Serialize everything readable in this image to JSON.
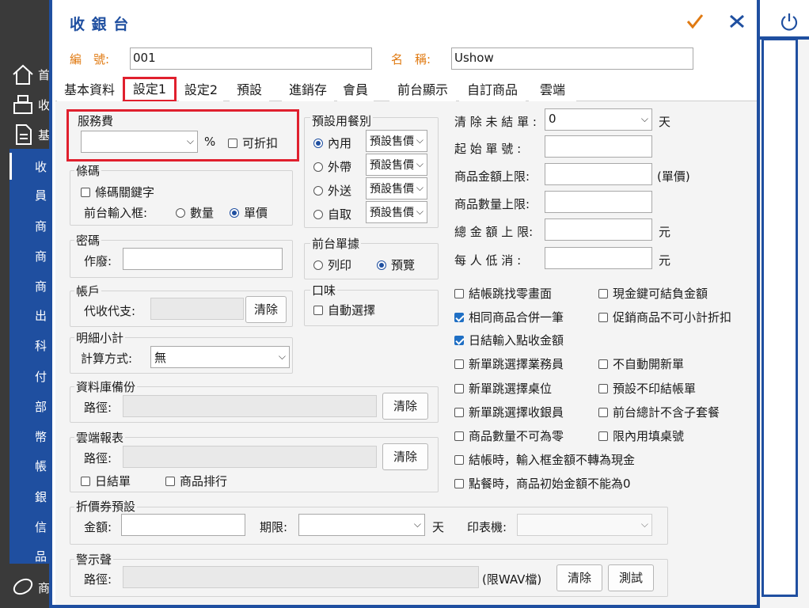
{
  "app": {
    "sidebar": [
      {
        "label": "首",
        "icon": "home-icon"
      },
      {
        "label": "收",
        "icon": "register-icon"
      },
      {
        "label": "基",
        "icon": "document-icon"
      },
      {
        "label": "收"
      },
      {
        "label": "員"
      },
      {
        "label": "商"
      },
      {
        "label": "商"
      },
      {
        "label": "商"
      },
      {
        "label": "出"
      },
      {
        "label": "科"
      },
      {
        "label": "付"
      },
      {
        "label": "部"
      },
      {
        "label": "幣"
      },
      {
        "label": "帳"
      },
      {
        "label": "銀"
      },
      {
        "label": "信"
      },
      {
        "label": "品"
      },
      {
        "label": "商",
        "icon": "bread-icon"
      }
    ]
  },
  "dialog": {
    "title": "收 銀 台",
    "code_label": "編　號:",
    "code_value": "001",
    "name_label": "名　稱:",
    "name_value": "Ushow",
    "tabs": [
      "基本資料",
      "設定1",
      "設定2",
      "預設",
      "進銷存",
      "會員",
      "前台顯示",
      "自訂商品",
      "雲端"
    ],
    "active_tab": "設定1"
  },
  "service": {
    "title": "服務費",
    "unit": "%",
    "discountable": "可折扣"
  },
  "barcode": {
    "title": "條碼",
    "keyword": "條碼關鍵字",
    "input_label": "前台輸入框:",
    "opt_qty": "數量",
    "opt_price": "單價"
  },
  "password": {
    "title": "密碼",
    "void_label": "作廢:"
  },
  "account": {
    "title": "帳戶",
    "label": "代收代支:",
    "clear": "清除"
  },
  "subtotal": {
    "title": "明細小計",
    "label": "計算方式:",
    "value": "無"
  },
  "backup": {
    "title": "資料庫備份",
    "label": "路徑:",
    "clear": "清除"
  },
  "cloud": {
    "title": "雲端報表",
    "label": "路徑:",
    "clear": "清除",
    "daily": "日結單",
    "ranking": "商品排行"
  },
  "meal": {
    "title": "預設用餐別",
    "rows": [
      {
        "label": "內用",
        "value": "預設售價",
        "selected": true
      },
      {
        "label": "外帶",
        "value": "預設售價",
        "selected": false
      },
      {
        "label": "外送",
        "value": "預設售價",
        "selected": false
      },
      {
        "label": "自取",
        "value": "預設售價",
        "selected": false
      }
    ]
  },
  "receipt": {
    "title": "前台單據",
    "opt_print": "列印",
    "opt_preview": "預覽"
  },
  "taste": {
    "title": "口味",
    "auto": "自動選擇"
  },
  "right": {
    "clear_label": "清 除 未 結 單 :",
    "clear_value": "0",
    "clear_unit": "天",
    "start_label": "起 始 單 號 :",
    "price_limit_label": "商品金額上限:",
    "price_limit_unit": "(單價)",
    "qty_limit_label": "商品數量上限:",
    "total_limit_label": "總 金 額 上 限:",
    "total_limit_unit": "元",
    "min_label": "每 人 低 消 :",
    "min_unit": "元"
  },
  "options_left": [
    {
      "label": "結帳跳找零畫面",
      "checked": false
    },
    {
      "label": "相同商品合併一筆",
      "checked": true
    },
    {
      "label": "日結輸入點收金額",
      "checked": true
    },
    {
      "label": "新單跳選擇業務員",
      "checked": false
    },
    {
      "label": "新單跳選擇桌位",
      "checked": false
    },
    {
      "label": "新單跳選擇收銀員",
      "checked": false
    },
    {
      "label": "商品數量不可為零",
      "checked": false
    },
    {
      "label": "結帳時，輸入框金額不轉為現金",
      "checked": false
    },
    {
      "label": "點餐時，商品初始金額不能為0",
      "checked": false
    }
  ],
  "options_right": [
    {
      "label": "現金鍵可結負金額",
      "checked": false
    },
    {
      "label": "促銷商品不可小計折扣",
      "checked": false
    },
    {
      "label": "不自動開新單",
      "checked": false
    },
    {
      "label": "預設不印結帳單",
      "checked": false
    },
    {
      "label": "前台總計不含子套餐",
      "checked": false
    },
    {
      "label": "限內用填桌號",
      "checked": false
    }
  ],
  "coupon": {
    "title": "折價券預設",
    "amount_label": "金額:",
    "period_label": "期限:",
    "day_unit": "天",
    "printer_label": "印表機:"
  },
  "alarm": {
    "title": "警示聲",
    "label": "路徑:",
    "hint": "(限WAV檔)",
    "clear": "清除",
    "test": "測試"
  },
  "colors": {
    "accent": "#1f4fa0",
    "highlight": "#e0202e",
    "orange": "#e07a12"
  }
}
